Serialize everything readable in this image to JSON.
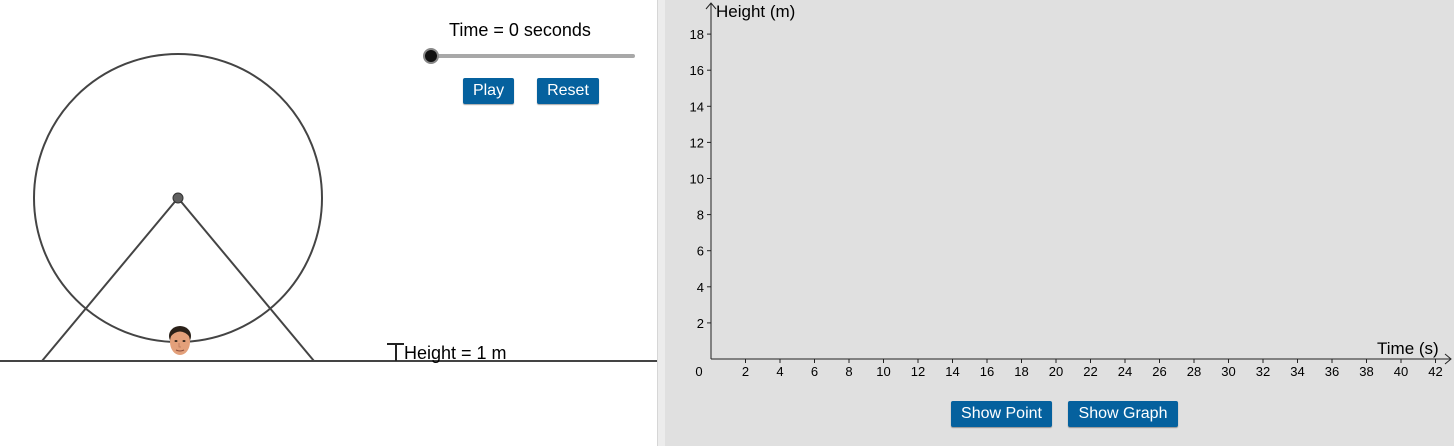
{
  "controls": {
    "time_label": "Time = 0 seconds",
    "slider_value": 0,
    "play_label": "Play",
    "reset_label": "Reset"
  },
  "scene": {
    "height_label": "Height = 1 m"
  },
  "graph": {
    "y_axis_label": "Height (m)",
    "x_axis_label": "Time (s)",
    "y_ticks": [
      "2",
      "4",
      "6",
      "8",
      "10",
      "12",
      "14",
      "16",
      "18"
    ],
    "x_ticks": [
      "0",
      "2",
      "4",
      "6",
      "8",
      "10",
      "12",
      "14",
      "16",
      "18",
      "20",
      "22",
      "24",
      "26",
      "28",
      "30",
      "32",
      "34",
      "36",
      "38",
      "40",
      "42"
    ],
    "show_point_label": "Show Point",
    "show_graph_label": "Show Graph"
  },
  "colors": {
    "button": "#05619e",
    "graph_bg": "#e0e0e0",
    "wheel": "#444444"
  }
}
